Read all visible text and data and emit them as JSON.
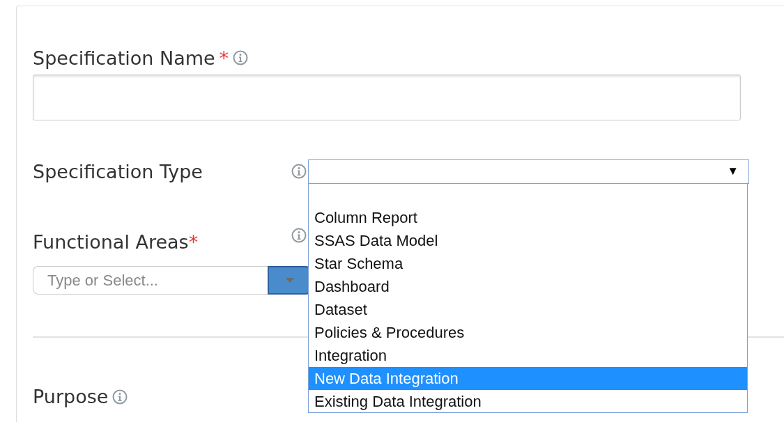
{
  "specification_name": {
    "label": "Specification Name",
    "required_mark": "*"
  },
  "specification_type": {
    "label": "Specification Type",
    "arrow": "▼",
    "expanded": true,
    "options": [
      {
        "label": "Column Report",
        "selected": false
      },
      {
        "label": "SSAS Data Model",
        "selected": false
      },
      {
        "label": "Star Schema",
        "selected": false
      },
      {
        "label": "Dashboard",
        "selected": false
      },
      {
        "label": "Dataset",
        "selected": false
      },
      {
        "label": "Policies & Procedures",
        "selected": false
      },
      {
        "label": "Integration",
        "selected": false
      },
      {
        "label": "New Data Integration",
        "selected": true
      },
      {
        "label": "Existing Data Integration",
        "selected": false
      }
    ]
  },
  "functional_areas": {
    "label": "Functional Areas",
    "required_mark": "*",
    "placeholder": "Type or Select..."
  },
  "purpose": {
    "label": "Purpose"
  }
}
